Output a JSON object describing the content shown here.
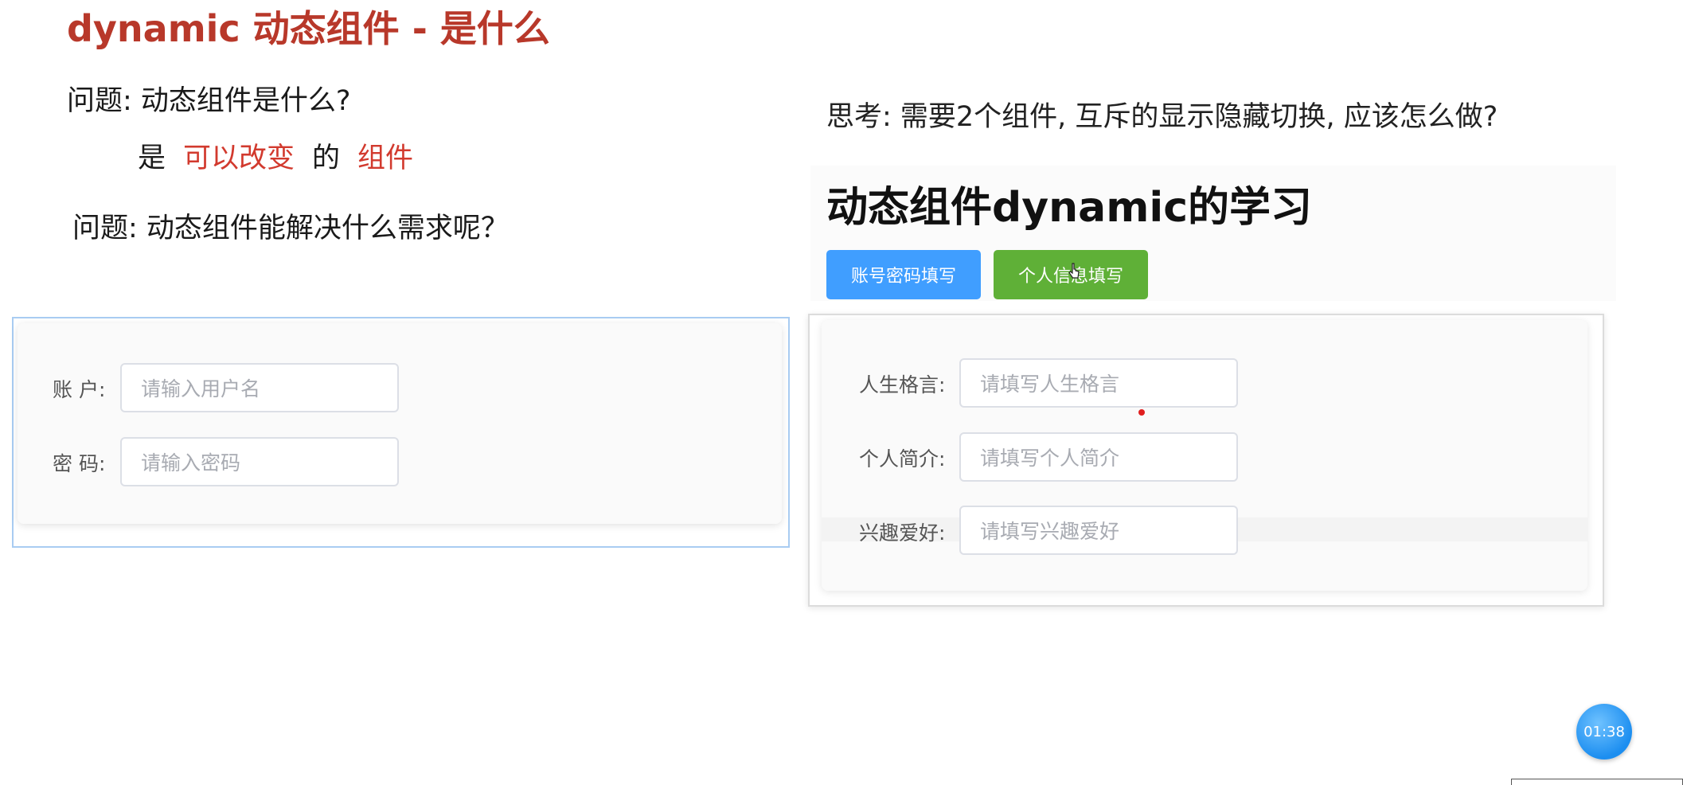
{
  "slide": {
    "title": "dynamic 动态组件 - 是什么",
    "question1": "问题: 动态组件是什么?",
    "answer": {
      "part1": "是",
      "part2": "可以改变",
      "part3": "的",
      "part4": "组件"
    },
    "question2": "问题: 动态组件能解决什么需求呢？",
    "think": "思考: 需要2个组件, 互斥的显示隐藏切换, 应该怎么做?"
  },
  "login_form": {
    "account_label": "账 户:",
    "account_placeholder": "请输入用户名",
    "password_label": "密 码:",
    "password_placeholder": "请输入密码"
  },
  "demo": {
    "heading": "动态组件dynamic的学习",
    "tab_account": "账号密码填写",
    "tab_personal": "个人信息填写",
    "personal_form": {
      "motto_label": "人生格言:",
      "motto_placeholder": "请填写人生格言",
      "intro_label": "个人简介:",
      "intro_placeholder": "请填写个人简介",
      "hobby_label": "兴趣爱好:",
      "hobby_placeholder": "请填写兴趣爱好"
    }
  },
  "timer": "01:38",
  "colors": {
    "title_red": "#b8382a",
    "accent_red": "#d23a2e",
    "primary_blue": "#409eff",
    "success_green": "#5fb037"
  }
}
